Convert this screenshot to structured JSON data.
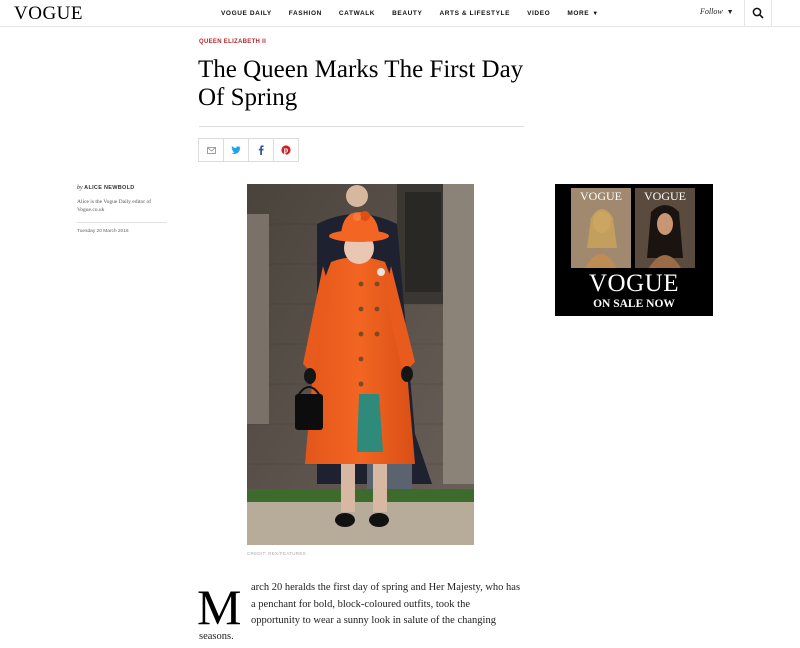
{
  "header": {
    "logo": "VOGUE",
    "nav": [
      {
        "label": "VOGUE DAILY"
      },
      {
        "label": "FASHION"
      },
      {
        "label": "CATWALK"
      },
      {
        "label": "BEAUTY"
      },
      {
        "label": "ARTS & LIFESTYLE"
      },
      {
        "label": "VIDEO"
      },
      {
        "label": "MORE"
      }
    ],
    "follow_label": "Follow",
    "icons": {
      "search": "search-icon",
      "caret": "chevron-down-icon"
    }
  },
  "article": {
    "kicker": "QUEEN ELIZABETH II",
    "title": "The Queen Marks The First Day Of Spring",
    "share": [
      {
        "name": "email",
        "icon": "mail-icon"
      },
      {
        "name": "twitter",
        "icon": "twitter-icon"
      },
      {
        "name": "facebook",
        "icon": "facebook-icon"
      },
      {
        "name": "pinterest",
        "icon": "pinterest-icon"
      }
    ],
    "byline": {
      "by": "by",
      "author": "ALICE NEWBOLD",
      "bio": "Alice is the Vogue Daily editor of Vogue.co.uk",
      "date": "Tuesday 20 March 2018"
    },
    "image_credit": "CREDIT: REX/FEATURES",
    "dropcap": "M",
    "body_lines": [
      "arch 20 heralds the first day of spring and Her Majesty, who has",
      "a penchant for bold, block-coloured outfits, took the",
      "opportunity to wear a sunny look in salute of the changing"
    ],
    "body_last": "seasons."
  },
  "ad": {
    "brand": "VOGUE",
    "tagline": "ON SALE NOW",
    "covers": [
      "VOGUE",
      "VOGUE"
    ]
  },
  "colors": {
    "kicker": "#b3262b",
    "coat": "#f26522",
    "twitter": "#1da1f2",
    "facebook": "#3b5998",
    "pinterest": "#cb2027"
  }
}
